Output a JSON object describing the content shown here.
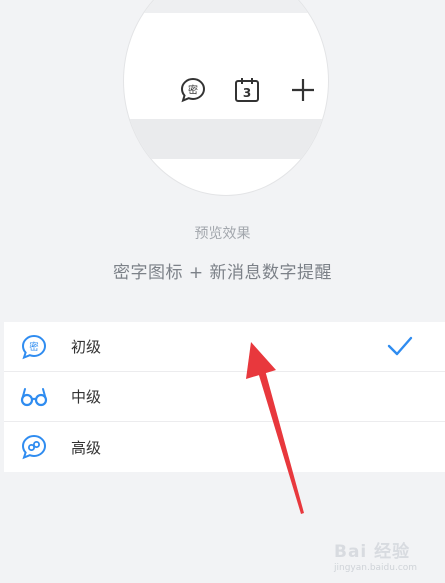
{
  "preview": {
    "calendar_day": "3",
    "secret_glyph": "密",
    "caption": "预览效果",
    "description": "密字图标 + 新消息数字提醒"
  },
  "options": [
    {
      "label": "初级",
      "icon": "secret-bubble-icon",
      "selected": true
    },
    {
      "label": "中级",
      "icon": "glasses-icon",
      "selected": false
    },
    {
      "label": "高级",
      "icon": "link-bubble-icon",
      "selected": false
    }
  ],
  "option_icon_glyph": "密",
  "watermark": {
    "text": "Bai 经验",
    "sub": "jingyan.baidu.com"
  },
  "colors": {
    "accent": "#2f8cf0",
    "arrow": "#e8383d",
    "background": "#f2f3f5"
  }
}
